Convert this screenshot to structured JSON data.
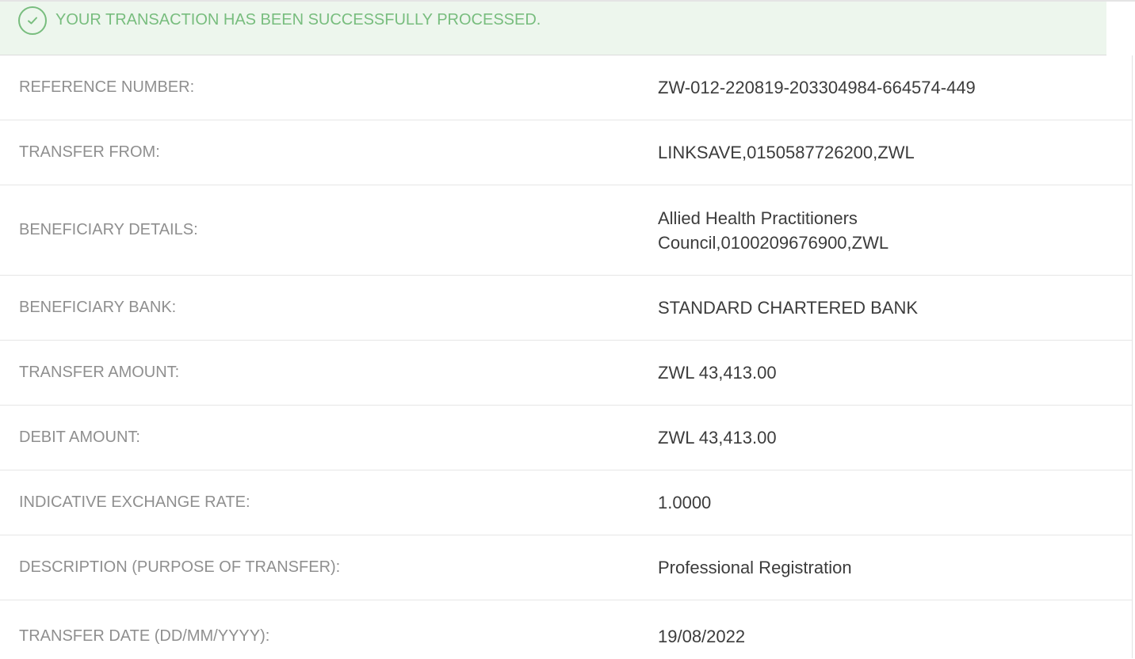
{
  "banner": {
    "icon": "check-circle-icon",
    "message": "YOUR TRANSACTION HAS BEEN SUCCESSFULLY PROCESSED.",
    "color": "#78bd7e",
    "background": "#edf6ed"
  },
  "details": {
    "reference_number": {
      "label": "REFERENCE NUMBER:",
      "value": "ZW-012-220819-203304984-664574-449"
    },
    "transfer_from": {
      "label": "TRANSFER FROM:",
      "value": "LINKSAVE,0150587726200,ZWL"
    },
    "beneficiary_details": {
      "label": "BENEFICIARY DETAILS:",
      "value_line1": "Allied Health Practitioners",
      "value_line2": "Council,0100209676900,ZWL"
    },
    "beneficiary_bank": {
      "label": "BENEFICIARY BANK:",
      "value": "STANDARD CHARTERED BANK"
    },
    "transfer_amount": {
      "label": "TRANSFER AMOUNT:",
      "value": "ZWL 43,413.00"
    },
    "debit_amount": {
      "label": "DEBIT AMOUNT:",
      "value": "ZWL 43,413.00"
    },
    "exchange_rate": {
      "label": "INDICATIVE EXCHANGE RATE:",
      "value": "1.0000"
    },
    "description": {
      "label": "DESCRIPTION (PURPOSE OF TRANSFER):",
      "value": "Professional Registration"
    },
    "transfer_date": {
      "label": "TRANSFER DATE (DD/MM/YYYY):",
      "value": "19/08/2022"
    }
  }
}
